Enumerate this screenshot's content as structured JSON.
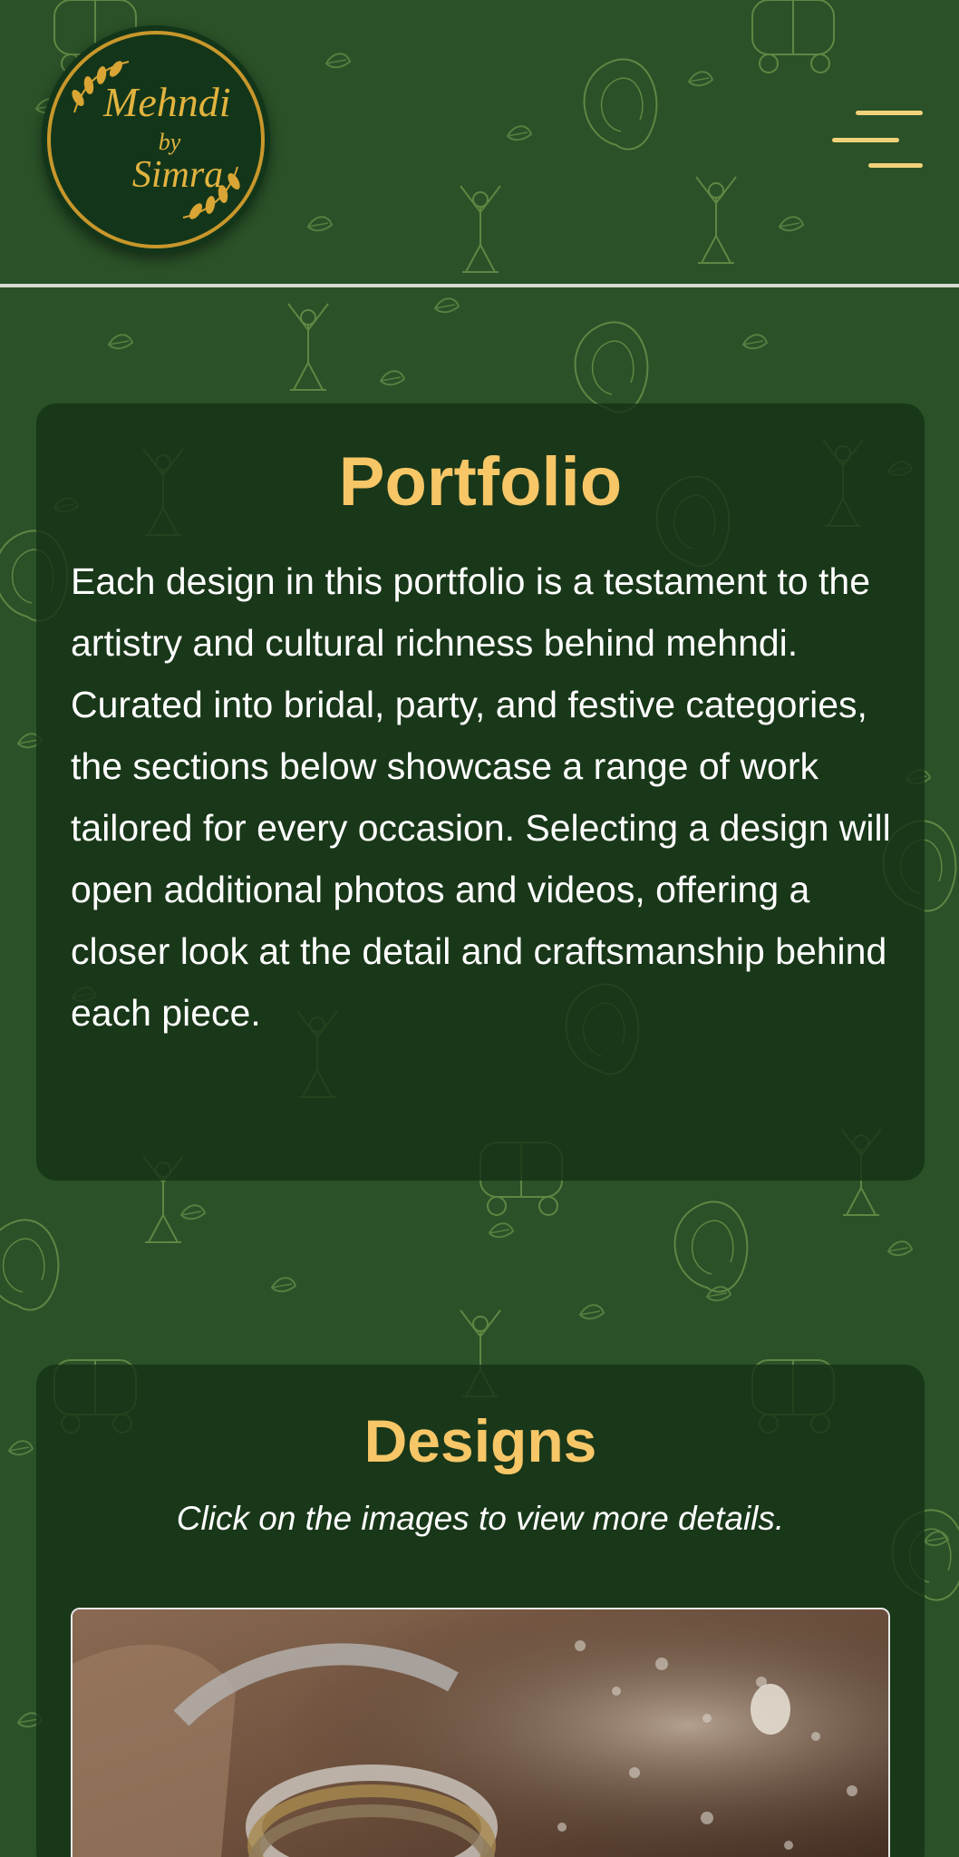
{
  "header": {
    "logo": {
      "line1": "Mehndi",
      "line2": "by",
      "line3": "Simra"
    },
    "menu_icon": "hamburger-menu-icon"
  },
  "portfolio": {
    "title": "Portfolio",
    "description": "Each design in this portfolio is a testament to the artistry and cultural richness behind mehndi. Curated into bridal, party, and festive categories, the sections below showcase a range of work tailored for every occasion. Selecting a design will open additional photos and videos, offering a closer look at the detail and craftsmanship behind each piece."
  },
  "designs": {
    "title": "Designs",
    "subtitle": "Click on the images to view more details."
  },
  "colors": {
    "background": "#2a5128",
    "card": "#14301655",
    "accent_gold": "#f6c667",
    "logo_bg": "#13361a"
  }
}
